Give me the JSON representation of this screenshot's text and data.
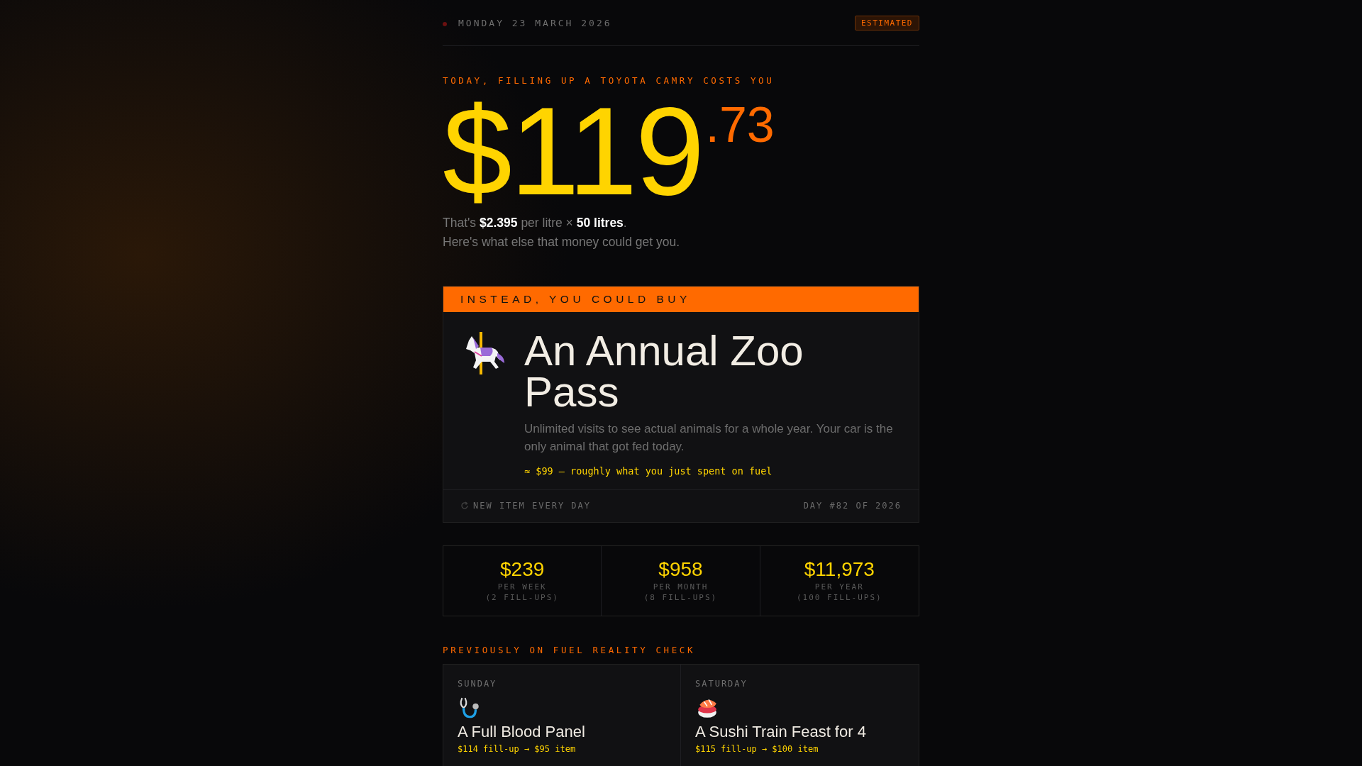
{
  "header": {
    "date": "MONDAY 23 MARCH 2026",
    "badge": "ESTIMATED"
  },
  "hero": {
    "label": "TODAY, FILLING UP A TOYOTA CAMRY COSTS YOU",
    "price_whole": "$119",
    "price_cents": ".73",
    "detail": "That's **$2.395** per litre × **50 litres**.",
    "subline": "Here's what else that money could get you."
  },
  "feature": {
    "banner": "INSTEAD, YOU COULD BUY",
    "kind": "carousel-horse",
    "title": "An Annual Zoo Pass",
    "description": "Unlimited visits to see actual animals for a whole year. Your car is the only animal that got fed today.",
    "comparison": "≈ $99 — roughly what you just spent on fuel",
    "footer_left": "NEW ITEM EVERY DAY",
    "footer_right": "DAY #82 OF 2026"
  },
  "stats": [
    {
      "amount": "$239",
      "period": "PER WEEK",
      "fillups": "(2 FILL-UPS)"
    },
    {
      "amount": "$958",
      "period": "PER MONTH",
      "fillups": "(8 FILL-UPS)"
    },
    {
      "amount": "$11,973",
      "period": "PER YEAR",
      "fillups": "(100 FILL-UPS)"
    }
  ],
  "previous": {
    "heading": "PREVIOUSLY ON FUEL REALITY CHECK",
    "items": [
      {
        "day": "SUNDAY",
        "kind": "stethoscope",
        "title": "A Full Blood Panel",
        "note": "$114 fill-up → $95 item"
      },
      {
        "day": "SATURDAY",
        "kind": "sushi",
        "title": "A Sushi Train Feast for 4",
        "note": "$115 fill-up → $100 item"
      }
    ]
  }
}
